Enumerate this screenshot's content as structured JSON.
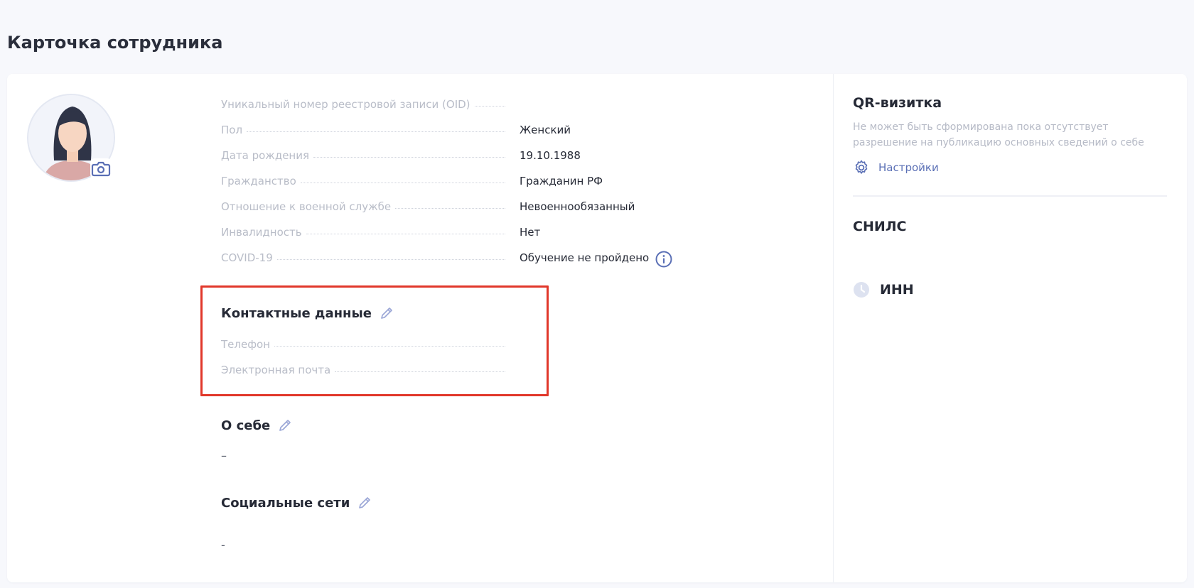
{
  "page": {
    "title": "Карточка сотрудника"
  },
  "profile": {
    "rows": [
      {
        "label": "Уникальный номер реестровой записи (OID)",
        "value": ""
      },
      {
        "label": "Пол",
        "value": "Женский"
      },
      {
        "label": "Дата рождения",
        "value": "19.10.1988"
      },
      {
        "label": "Гражданство",
        "value": "Гражданин РФ"
      },
      {
        "label": "Отношение к военной службе",
        "value": "Невоеннообязанный"
      },
      {
        "label": "Инвалидность",
        "value": "Нет"
      },
      {
        "label": "COVID-19",
        "value": "Обучение не пройдено"
      }
    ]
  },
  "contacts": {
    "title": "Контактные данные",
    "phone_label": "Телефон",
    "email_label": "Электронная почта"
  },
  "about": {
    "title": "О себе",
    "value": "–"
  },
  "social": {
    "title": "Социальные сети",
    "value": "-"
  },
  "sidebar": {
    "qr_title": "QR-визитка",
    "qr_description": "Не может быть сформирована пока отсутствует разрешение на публикацию основных сведений о себе",
    "settings_label": "Настройки",
    "snils_title": "СНИЛС",
    "inn_title": "ИНН"
  },
  "colors": {
    "accent": "#5a6fb5",
    "highlight_border": "#e1372a",
    "muted_text": "#b9bdc8"
  },
  "icons": [
    "camera-icon",
    "info-icon",
    "pencil-icon",
    "gear-icon",
    "clock-icon"
  ]
}
